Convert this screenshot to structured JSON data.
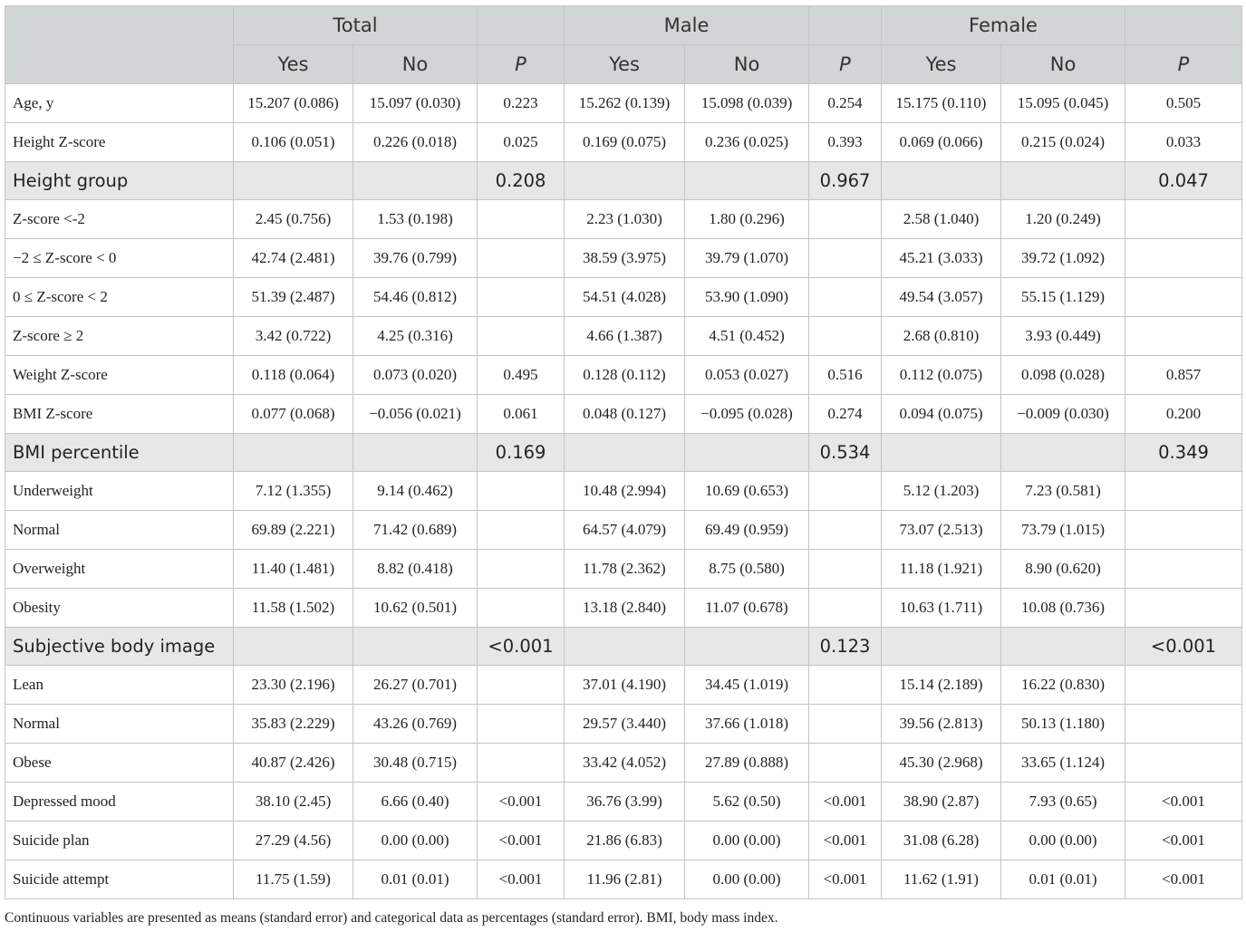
{
  "header": {
    "groups": [
      "Total",
      "Male",
      "Female"
    ],
    "yes": "Yes",
    "no": "No",
    "p": "P"
  },
  "rows": [
    {
      "type": "row",
      "label": "Age, y",
      "cells": [
        "15.207 (0.086)",
        "15.097 (0.030)",
        "0.223",
        "15.262 (0.139)",
        "15.098 (0.039)",
        "0.254",
        "15.175 (0.110)",
        "15.095 (0.045)",
        "0.505"
      ]
    },
    {
      "type": "row",
      "label": "Height Z-score",
      "cells": [
        "0.106 (0.051)",
        "0.226 (0.018)",
        "0.025",
        "0.169 (0.075)",
        "0.236 (0.025)",
        "0.393",
        "0.069 (0.066)",
        "0.215 (0.024)",
        "0.033"
      ]
    },
    {
      "type": "grp",
      "label": "Height group",
      "cells": [
        "",
        "",
        "0.208",
        "",
        "",
        "0.967",
        "",
        "",
        "0.047"
      ]
    },
    {
      "type": "row",
      "label": "Z-score <-2",
      "cells": [
        "2.45 (0.756)",
        "1.53 (0.198)",
        "",
        "2.23 (1.030)",
        "1.80 (0.296)",
        "",
        "2.58 (1.040)",
        "1.20 (0.249)",
        ""
      ]
    },
    {
      "type": "row",
      "label": "−2 ≤ Z-score < 0",
      "cells": [
        "42.74 (2.481)",
        "39.76 (0.799)",
        "",
        "38.59 (3.975)",
        "39.79 (1.070)",
        "",
        "45.21 (3.033)",
        "39.72 (1.092)",
        ""
      ]
    },
    {
      "type": "row",
      "label": "0 ≤ Z-score < 2",
      "cells": [
        "51.39 (2.487)",
        "54.46 (0.812)",
        "",
        "54.51 (4.028)",
        "53.90 (1.090)",
        "",
        "49.54 (3.057)",
        "55.15 (1.129)",
        ""
      ]
    },
    {
      "type": "row",
      "label": "Z-score ≥ 2",
      "cells": [
        "3.42 (0.722)",
        "4.25 (0.316)",
        "",
        "4.66 (1.387)",
        "4.51 (0.452)",
        "",
        "2.68 (0.810)",
        "3.93 (0.449)",
        ""
      ]
    },
    {
      "type": "row",
      "label": "Weight Z-score",
      "cells": [
        "0.118 (0.064)",
        "0.073 (0.020)",
        "0.495",
        "0.128 (0.112)",
        "0.053 (0.027)",
        "0.516",
        "0.112 (0.075)",
        "0.098 (0.028)",
        "0.857"
      ]
    },
    {
      "type": "row",
      "label": "BMI Z-score",
      "cells": [
        "0.077 (0.068)",
        "−0.056 (0.021)",
        "0.061",
        "0.048 (0.127)",
        "−0.095 (0.028)",
        "0.274",
        "0.094 (0.075)",
        "−0.009 (0.030)",
        "0.200"
      ]
    },
    {
      "type": "grp",
      "label": "BMI percentile",
      "cells": [
        "",
        "",
        "0.169",
        "",
        "",
        "0.534",
        "",
        "",
        "0.349"
      ]
    },
    {
      "type": "row",
      "label": "Underweight",
      "cells": [
        "7.12 (1.355)",
        "9.14 (0.462)",
        "",
        "10.48 (2.994)",
        "10.69 (0.653)",
        "",
        "5.12 (1.203)",
        "7.23 (0.581)",
        ""
      ]
    },
    {
      "type": "row",
      "label": "Normal",
      "cells": [
        "69.89 (2.221)",
        "71.42 (0.689)",
        "",
        "64.57 (4.079)",
        "69.49 (0.959)",
        "",
        "73.07 (2.513)",
        "73.79 (1.015)",
        ""
      ]
    },
    {
      "type": "row",
      "label": "Overweight",
      "cells": [
        "11.40 (1.481)",
        "8.82 (0.418)",
        "",
        "11.78 (2.362)",
        "8.75 (0.580)",
        "",
        "11.18 (1.921)",
        "8.90 (0.620)",
        ""
      ]
    },
    {
      "type": "row",
      "label": "Obesity",
      "cells": [
        "11.58 (1.502)",
        "10.62 (0.501)",
        "",
        "13.18 (2.840)",
        "11.07 (0.678)",
        "",
        "10.63 (1.711)",
        "10.08 (0.736)",
        ""
      ]
    },
    {
      "type": "grp",
      "label": "Subjective body image",
      "cells": [
        "",
        "",
        "<0.001",
        "",
        "",
        "0.123",
        "",
        "",
        "<0.001"
      ]
    },
    {
      "type": "row",
      "label": "Lean",
      "cells": [
        "23.30 (2.196)",
        "26.27 (0.701)",
        "",
        "37.01 (4.190)",
        "34.45 (1.019)",
        "",
        "15.14 (2.189)",
        "16.22 (0.830)",
        ""
      ]
    },
    {
      "type": "row",
      "label": "Normal",
      "cells": [
        "35.83 (2.229)",
        "43.26 (0.769)",
        "",
        "29.57 (3.440)",
        "37.66 (1.018)",
        "",
        "39.56 (2.813)",
        "50.13 (1.180)",
        ""
      ]
    },
    {
      "type": "row",
      "label": "Obese",
      "cells": [
        "40.87 (2.426)",
        "30.48 (0.715)",
        "",
        "33.42 (4.052)",
        "27.89 (0.888)",
        "",
        "45.30 (2.968)",
        "33.65 (1.124)",
        ""
      ]
    },
    {
      "type": "row",
      "label": "Depressed mood",
      "cells": [
        "38.10 (2.45)",
        "6.66 (0.40)",
        "<0.001",
        "36.76 (3.99)",
        "5.62 (0.50)",
        "<0.001",
        "38.90 (2.87)",
        "7.93 (0.65)",
        "<0.001"
      ]
    },
    {
      "type": "row",
      "label": "Suicide plan",
      "cells": [
        "27.29 (4.56)",
        "0.00 (0.00)",
        "<0.001",
        "21.86 (6.83)",
        "0.00 (0.00)",
        "<0.001",
        "31.08 (6.28)",
        "0.00 (0.00)",
        "<0.001"
      ]
    },
    {
      "type": "row",
      "label": "Suicide attempt",
      "cells": [
        "11.75 (1.59)",
        "0.01 (0.01)",
        "<0.001",
        "11.96 (2.81)",
        "0.00 (0.00)",
        "<0.001",
        "11.62 (1.91)",
        "0.01 (0.01)",
        "<0.001"
      ]
    }
  ],
  "footnote": "Continuous variables are presented as means (standard error) and categorical data as percentages (standard error). BMI, body mass index."
}
